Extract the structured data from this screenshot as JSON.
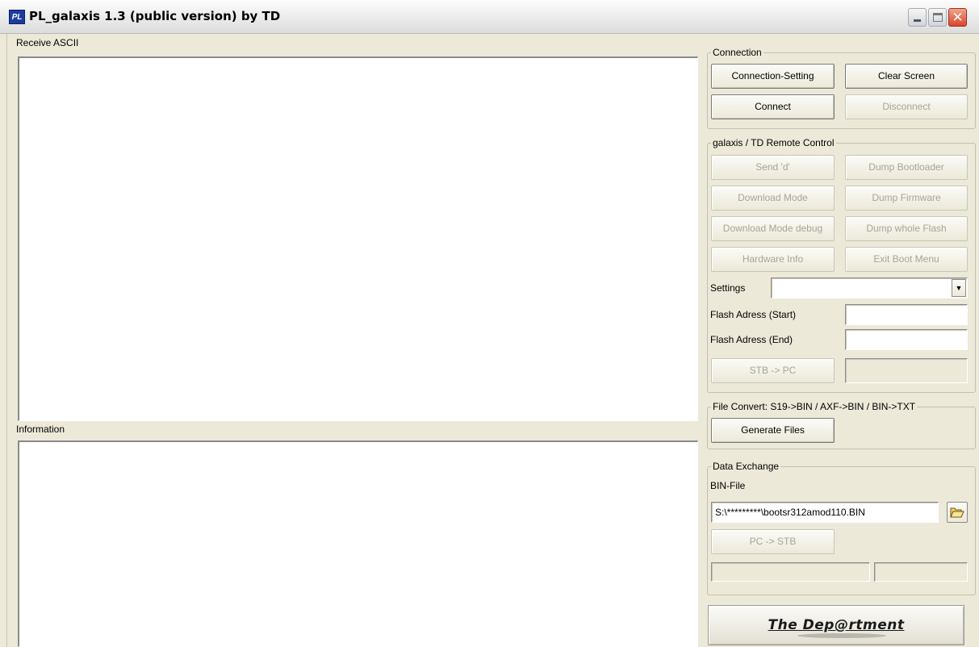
{
  "window": {
    "icon_text": "PL",
    "title": "PL_galaxis 1.3 (public version) by TD",
    "close_glyph": "✕"
  },
  "receive": {
    "label": "Receive ASCII"
  },
  "information": {
    "label": "Information"
  },
  "connection": {
    "title": "Connection",
    "connection_setting": "Connection-Setting",
    "clear_screen": "Clear Screen",
    "connect": "Connect",
    "disconnect": "Disconnect"
  },
  "remote": {
    "title": "galaxis / TD Remote Control",
    "send_d": "Send 'd'",
    "dump_bootloader": "Dump Bootloader",
    "download_mode": "Download Mode",
    "dump_firmware": "Dump Firmware",
    "download_mode_debug": "Download Mode debug",
    "dump_whole_flash": "Dump whole Flash",
    "hardware_info": "Hardware Info",
    "exit_boot_menu": "Exit Boot Menu",
    "settings_label": "Settings",
    "settings_value": "",
    "flash_start_label": "Flash Adress (Start)",
    "flash_start_value": "",
    "flash_end_label": "Flash Adress (End)",
    "flash_end_value": "",
    "stb_to_pc": "STB -> PC",
    "stb_to_pc_status": ""
  },
  "file_convert": {
    "title": "File Convert: S19->BIN / AXF->BIN / BIN->TXT",
    "generate_files": "Generate Files"
  },
  "data_exchange": {
    "title": "Data Exchange",
    "bin_file_label": "BIN-File",
    "bin_file_value": "S:\\*********\\bootsr312amod110.BIN",
    "pc_to_stb": "PC -> STB",
    "status_left": "",
    "status_right": ""
  },
  "logo": {
    "text": "The Dep@rtment"
  },
  "icons": {
    "dropdown": "chevron-down-icon",
    "browse": "open-folder-icon",
    "app": "app-icon"
  }
}
